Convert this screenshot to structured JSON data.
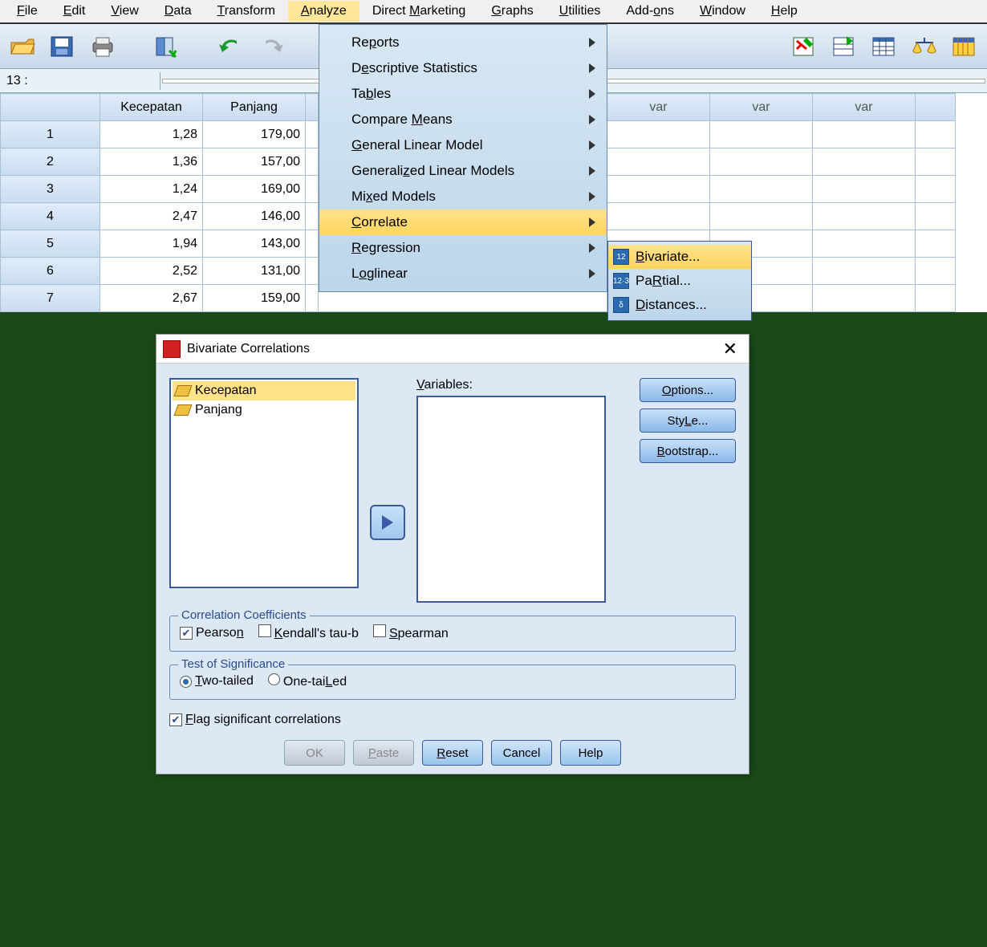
{
  "menubar": {
    "file": "File",
    "file_u": "F",
    "edit": "Edit",
    "edit_u": "E",
    "view": "View",
    "view_u": "V",
    "data": "Data",
    "data_u": "D",
    "transform": "Transform",
    "transform_u": "T",
    "analyze": "Analyze",
    "analyze_u": "A",
    "dm": "Direct Marketing",
    "dm_u": "M",
    "graphs": "Graphs",
    "graphs_u": "G",
    "utilities": "Utilities",
    "utilities_u": "U",
    "addons": "Add-ons",
    "addons_u": "o",
    "window": "Window",
    "window_u": "W",
    "help": "Help",
    "help_u": "H"
  },
  "cell_addr": "13 :",
  "columns": {
    "c1": "Kecepatan",
    "c2": "Panjang",
    "var": "var"
  },
  "rows": [
    {
      "n": "1",
      "a": "1,28",
      "b": "179,00"
    },
    {
      "n": "2",
      "a": "1,36",
      "b": "157,00"
    },
    {
      "n": "3",
      "a": "1,24",
      "b": "169,00"
    },
    {
      "n": "4",
      "a": "2,47",
      "b": "146,00"
    },
    {
      "n": "5",
      "a": "1,94",
      "b": "143,00"
    },
    {
      "n": "6",
      "a": "2,52",
      "b": "131,00"
    },
    {
      "n": "7",
      "a": "2,67",
      "b": "159,00"
    }
  ],
  "analyze_menu": {
    "reports": "Reports",
    "reports_u": "p",
    "ds": "Descriptive Statistics",
    "ds_u": "e",
    "tables": "Tables",
    "tables_u": "b",
    "cm": "Compare Means",
    "cm_u": "M",
    "glm": "General Linear Model",
    "glm_u": "G",
    "gzm": "Generalized Linear Models",
    "gzm_u": "z",
    "mixed": "Mixed Models",
    "mixed_u": "x",
    "corr": "Correlate",
    "corr_u": "C",
    "reg": "Regression",
    "reg_u": "R",
    "log": "Loglinear",
    "log_u": "o"
  },
  "corr_sub": {
    "biv": "Bivariate...",
    "biv_u": "B",
    "partial": "Partial...",
    "partial_u": "R",
    "dist": "Distances...",
    "dist_u": "D"
  },
  "dialog": {
    "title": "Bivariate Correlations",
    "vars_label": "Variables:",
    "vars_u": "V",
    "source_items": [
      "Kecepatan",
      "Panjang"
    ],
    "side": {
      "options": "Options...",
      "options_u": "O",
      "style": "Style...",
      "style_u": "L",
      "boot": "Bootstrap...",
      "boot_u": "B"
    },
    "cc_legend": "Correlation Coefficients",
    "pearson": "Pearson",
    "pearson_u": "n",
    "kendall": "Kendall's tau-b",
    "kendall_u": "K",
    "spearman": "Spearman",
    "spearman_u": "S",
    "tos_legend": "Test of Significance",
    "two": "Two-tailed",
    "two_u": "T",
    "one": "One-tailed",
    "one_u": "L",
    "flag": "Flag significant correlations",
    "flag_u": "F",
    "btns": {
      "ok": "OK",
      "paste": "Paste",
      "paste_u": "P",
      "reset": "Reset",
      "reset_u": "R",
      "cancel": "Cancel",
      "help": "Help"
    }
  }
}
